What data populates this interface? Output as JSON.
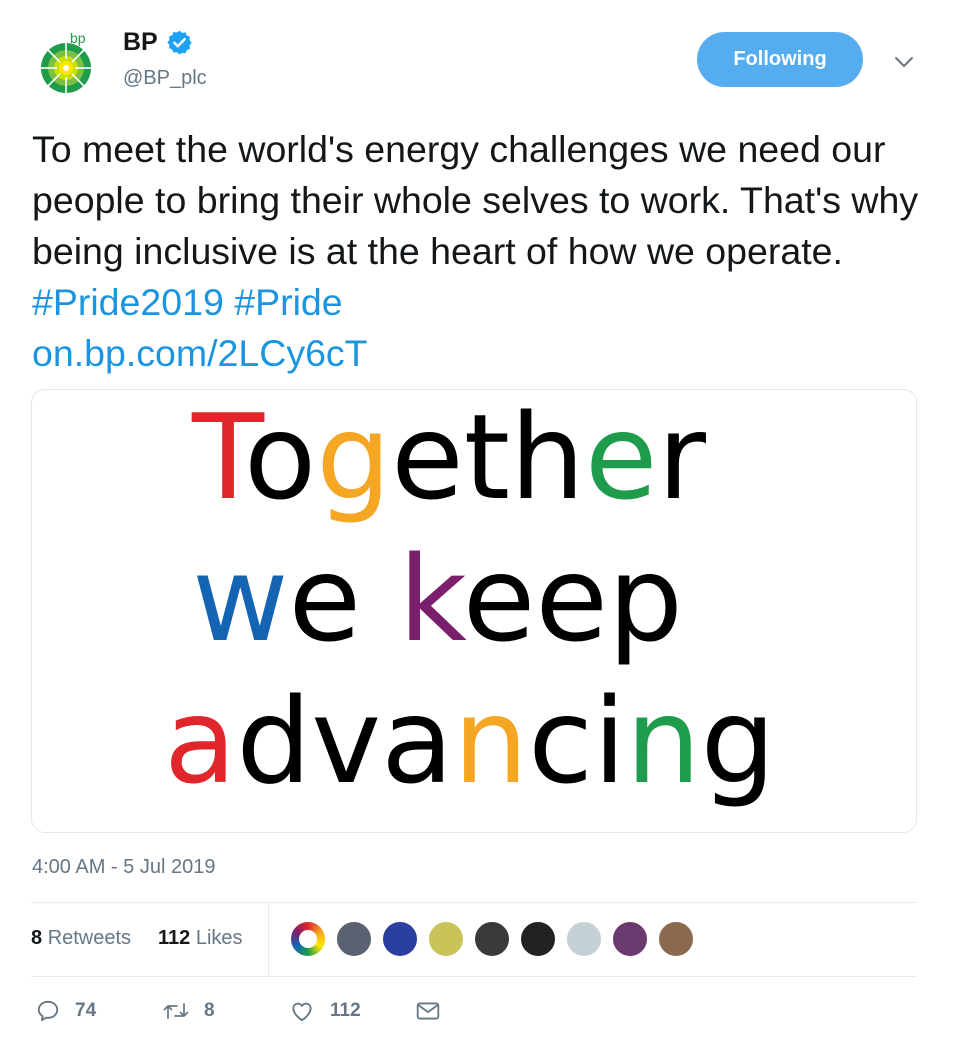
{
  "account": {
    "logo_text": "bp",
    "display_name": "BP",
    "handle": "@BP_plc",
    "follow_label": "Following"
  },
  "tweet": {
    "text": "To meet the world's energy challenges we need our people to bring their whole selves to work. That's why being inclusive is at the heart of how we operate.",
    "hashtags": [
      "#Pride2019",
      "#Pride"
    ],
    "link": "on.bp.com/2LCy6cT",
    "timestamp": "4:00 AM - 5 Jul 2019"
  },
  "media": {
    "line1": "Together",
    "line2": "we keep",
    "line3": "advancing",
    "colors": {
      "red": "#e0262b",
      "orange": "#f5a623",
      "green": "#1e9b4b",
      "blue": "#1464b4",
      "purple": "#7a1f6e",
      "black": "#000000"
    }
  },
  "stats": {
    "retweets_count": "8",
    "retweets_label": "Retweets",
    "likes_count": "112",
    "likes_label": "Likes"
  },
  "facepile": [
    {
      "icon": "rainbow-ring-avatar",
      "color": "#f2f2f2"
    },
    {
      "icon": "person-avatar",
      "color": "#5a6170"
    },
    {
      "icon": "eu-flag-avatar",
      "color": "#2a3f9f"
    },
    {
      "icon": "tree-avatar",
      "color": "#c9c45a"
    },
    {
      "icon": "group-avatar",
      "color": "#3a3a3a"
    },
    {
      "icon": "cartoon-avatar",
      "color": "#222222"
    },
    {
      "icon": "default-avatar",
      "color": "#c4cfd6"
    },
    {
      "icon": "crowd-avatar",
      "color": "#6a3a6f"
    },
    {
      "icon": "couple-avatar",
      "color": "#8a6a4f"
    }
  ],
  "actions": {
    "reply_count": "74",
    "retweet_count": "8",
    "like_count": "112"
  }
}
